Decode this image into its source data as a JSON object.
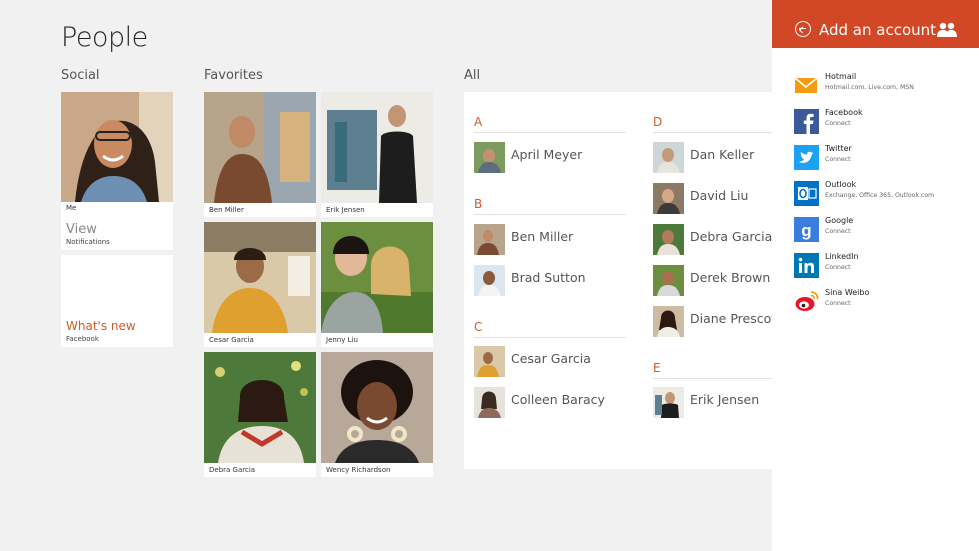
{
  "app": {
    "title": "People"
  },
  "sections": {
    "social": "Social",
    "favorites": "Favorites",
    "all": "All"
  },
  "social": {
    "me": {
      "caption": "Me",
      "view_label": "View",
      "view_sub": "Notifications"
    },
    "whats_new": {
      "label": "What's new",
      "sub": "Facebook"
    }
  },
  "favorites": [
    {
      "name": "Ben Miller"
    },
    {
      "name": "Erik Jensen"
    },
    {
      "name": "Cesar Garcia"
    },
    {
      "name": "Jenny Liu"
    },
    {
      "name": "Debra Garcia"
    },
    {
      "name": "Wency Richardson"
    }
  ],
  "all": {
    "groups": [
      {
        "letter": "A",
        "contacts": [
          "April Meyer"
        ]
      },
      {
        "letter": "B",
        "contacts": [
          "Ben Miller",
          "Brad Sutton"
        ]
      },
      {
        "letter": "C",
        "contacts": [
          "Cesar Garcia",
          "Colleen Baracy"
        ]
      },
      {
        "letter": "D",
        "contacts": [
          "Dan Keller",
          "David Liu",
          "Debra Garcia",
          "Derek Brown",
          "Diane Prescott"
        ]
      },
      {
        "letter": "E",
        "contacts": [
          "Erik Jensen"
        ]
      }
    ]
  },
  "charm": {
    "title": "Add an account",
    "accent": "#d24726",
    "accounts": [
      {
        "name": "Hotmail",
        "sub": "Hotmail.com, Live.com, MSN",
        "icon": "hotmail-icon",
        "color": "#f39c12"
      },
      {
        "name": "Facebook",
        "sub": "Connect",
        "icon": "facebook-icon",
        "color": "#3b5998"
      },
      {
        "name": "Twitter",
        "sub": "Connect",
        "icon": "twitter-icon",
        "color": "#1da1f2"
      },
      {
        "name": "Outlook",
        "sub": "Exchange, Office 365, Outlook.com",
        "icon": "outlook-icon",
        "color": "#0072c6"
      },
      {
        "name": "Google",
        "sub": "Connect",
        "icon": "google-icon",
        "color": "#3b7ddd"
      },
      {
        "name": "LinkedIn",
        "sub": "Connect",
        "icon": "linkedin-icon",
        "color": "#0077b5"
      },
      {
        "name": "Sina Weibo",
        "sub": "Connect",
        "icon": "weibo-icon",
        "color": "#e6162d"
      }
    ]
  }
}
